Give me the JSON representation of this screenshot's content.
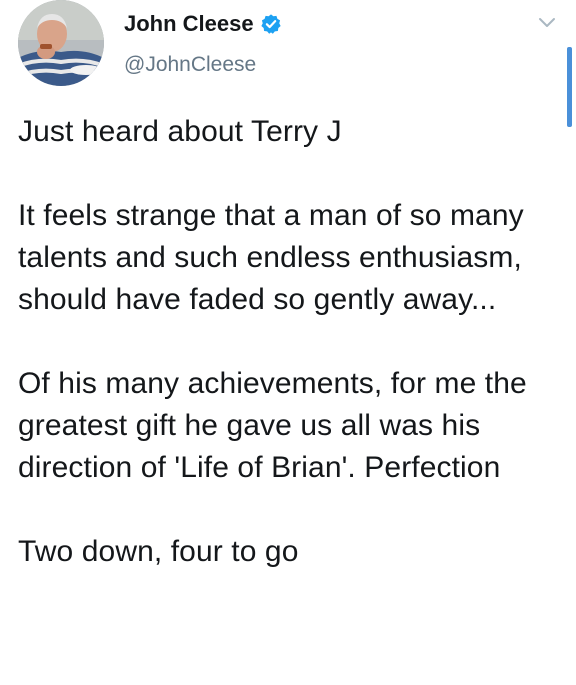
{
  "author": {
    "display_name": "John Cleese",
    "handle": "@JohnCleese",
    "verified": true,
    "avatar_icon": "user-avatar-photo"
  },
  "controls": {
    "more_icon": "chevron-down-icon",
    "scrollbar_color": "#4a90d9"
  },
  "tweet": {
    "paragraphs": [
      "Just heard about Terry J",
      "It feels strange that a man of so many talents and such endless enthusiasm, should have faded so gently away...",
      "Of his many achievements, for me the greatest gift he gave us all was his direction of 'Life of Brian'. Perfection",
      "Two down, four to go"
    ]
  },
  "colors": {
    "text": "#14171a",
    "secondary": "#657786",
    "verified_badge": "#1da1f2"
  }
}
